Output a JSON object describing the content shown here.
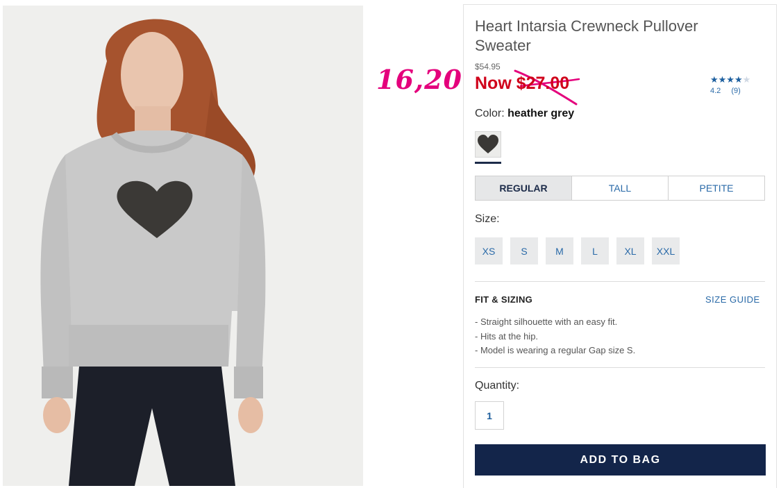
{
  "product": {
    "title": "Heart Intarsia Crewneck Pullover Sweater",
    "original_price": "$54.95",
    "sale_price": "Now $27.00",
    "rating": {
      "score": "4.2",
      "count": "(9)",
      "stars_filled": 4,
      "stars_total": 5,
      "stars_text": "★★★★",
      "stars_empty_text": "★"
    }
  },
  "annotation": {
    "handwritten_price": "16,20",
    "color": "#e4007c"
  },
  "color": {
    "label": "Color:",
    "value": "heather grey"
  },
  "fit_tabs": [
    "REGULAR",
    "TALL",
    "PETITE"
  ],
  "selected_fit": "REGULAR",
  "size": {
    "label": "Size:",
    "options": [
      "XS",
      "S",
      "M",
      "L",
      "XL",
      "XXL"
    ]
  },
  "fit_sizing": {
    "heading": "FIT & SIZING",
    "size_guide_link": "SIZE GUIDE",
    "details": [
      "- Straight silhouette with an easy fit.",
      "- Hits at the hip.",
      "- Model is wearing a regular Gap size S."
    ]
  },
  "quantity": {
    "label": "Quantity:",
    "value": "1"
  },
  "cta": {
    "add_to_bag": "ADD TO BAG"
  },
  "colors": {
    "sale_red": "#d0021b",
    "navy": "#13254a",
    "link_blue": "#2a6aa8"
  }
}
